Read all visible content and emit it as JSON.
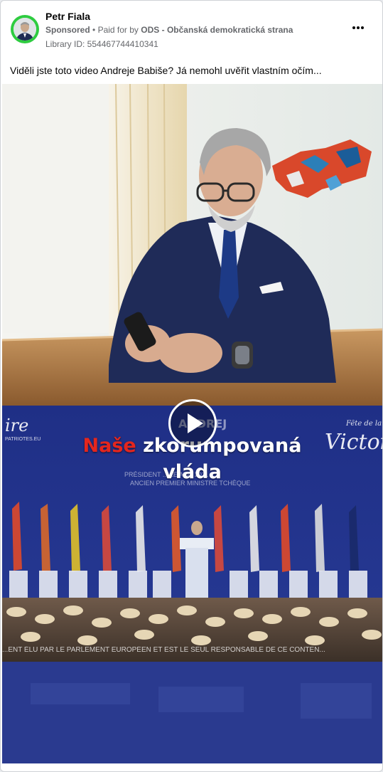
{
  "post": {
    "author_name": "Petr Fiala",
    "sponsored_label": "Sponsored",
    "paid_for_prefix": "Paid for by",
    "payer": "ODS - Občanská demokratická strana",
    "library_id": "Library ID: 554467744410341",
    "caption": "Viděli jste toto video Andreje Babiše? Já nemohl uvěřit vlastním očím..."
  },
  "video": {
    "overlay_word_red": "Naše",
    "overlay_word_white": "zkorumpovaná",
    "overlay_line2": "vláda",
    "banner_left": "ire",
    "banner_left_small": "PATRIOTES.EU",
    "banner_right": "Victoire",
    "banner_right_small": "Fête de la",
    "banner_center": "ANDREJ",
    "banner_subtitle_1": "PRÉSIDENT ... LE ANO 2011",
    "banner_subtitle_2": "ANCIEN PREMIER MINISTRE TCHÈQUE",
    "ticker": "...ENT ÉLU PAR LE PARLEMENT EUROPÉEN ET EST LE SEUL RESPONSABLE DE CE CONTEN..."
  },
  "colors": {
    "accent_green": "#2ecc40",
    "overlay_red": "#e4261e",
    "stage_blue": "#22328a"
  }
}
